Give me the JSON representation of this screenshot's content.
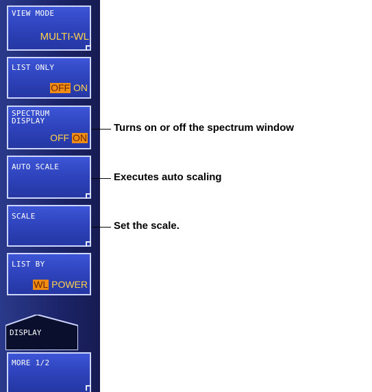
{
  "softkeys": {
    "view_mode": {
      "caption": "VIEW MODE",
      "value": "MULTI-WL"
    },
    "list_only": {
      "caption": "LIST ONLY",
      "off": "OFF",
      "on": "ON"
    },
    "spectrum_display": {
      "caption": "SPECTRUM\nDISPLAY",
      "off": "OFF",
      "on": "ON"
    },
    "auto_scale": {
      "caption": "AUTO SCALE"
    },
    "scale": {
      "caption": "SCALE"
    },
    "list_by": {
      "caption": "LIST BY",
      "wl": "WL",
      "power": "POWER"
    },
    "display_tab": {
      "label": "DISPLAY"
    },
    "more": {
      "caption": "MORE 1/2"
    }
  },
  "callouts": {
    "spectrum": "Turns on or off the spectrum window",
    "auto_scale": "Executes auto scaling",
    "scale": "Set the scale."
  },
  "colors": {
    "selected_bg": "#f08c14",
    "value_text": "#ffd24a",
    "key_blue": "#2f44be"
  }
}
